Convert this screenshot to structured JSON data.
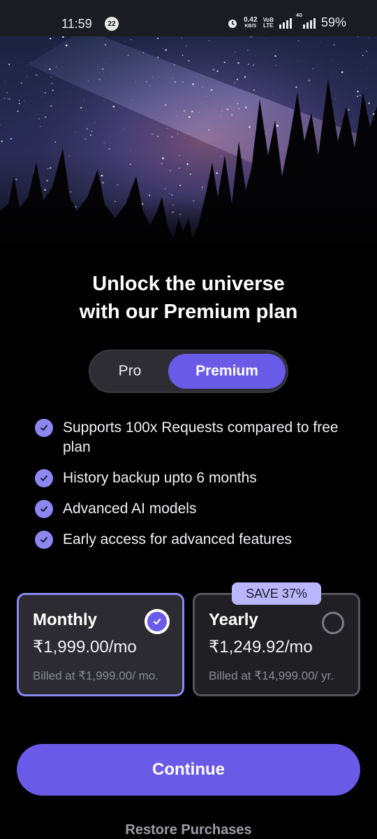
{
  "status_bar": {
    "time": "11:59",
    "notification_count": "22",
    "network_speed_value": "0.42",
    "network_speed_unit": "KB/S",
    "volte_top": "VoB",
    "volte_bottom": "LTE",
    "network_type": "4G",
    "battery": "59%"
  },
  "hero": {
    "image": "night-sky-forest"
  },
  "heading": {
    "line1": "Unlock the universe",
    "line2": "with our Premium plan"
  },
  "plan_toggle": {
    "options": [
      "Pro",
      "Premium"
    ],
    "selected": "Premium"
  },
  "features": [
    {
      "text": "Supports 100x Requests compared to free plan"
    },
    {
      "text": "History backup upto 6 months"
    },
    {
      "text": "Advanced AI models"
    },
    {
      "text": "Early access for advanced features"
    }
  ],
  "plans": {
    "monthly": {
      "name": "Monthly",
      "price": "₹1,999.00/mo",
      "billed": "Billed at ₹1,999.00/ mo.",
      "selected": true
    },
    "yearly": {
      "name": "Yearly",
      "price": "₹1,249.92/mo",
      "billed": "Billed at ₹14,999.00/ yr.",
      "badge": "SAVE 37%",
      "selected": false
    }
  },
  "actions": {
    "continue_label": "Continue",
    "restore_label": "Restore Purchases"
  },
  "colors": {
    "accent": "#6a5ae8",
    "check": "#8d87f2",
    "badge": "#b9b6fb",
    "background": "#000000"
  }
}
